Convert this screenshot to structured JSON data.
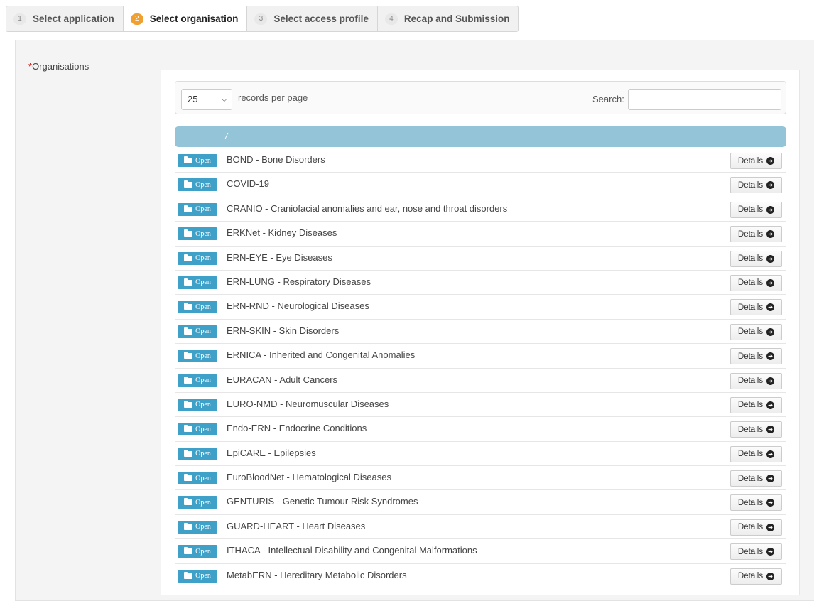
{
  "steps": [
    {
      "num": "1",
      "label": "Select application",
      "active": false
    },
    {
      "num": "2",
      "label": "Select organisation",
      "active": true
    },
    {
      "num": "3",
      "label": "Select access profile",
      "active": false
    },
    {
      "num": "4",
      "label": "Recap and Submission",
      "active": false
    }
  ],
  "form": {
    "required_mark": "*",
    "label": "Organisations"
  },
  "table_controls": {
    "page_size": "25",
    "records_per_page_label": "records per page",
    "search_label": "Search:",
    "search_value": ""
  },
  "table": {
    "header": "/",
    "open_label": "Open",
    "details_label": "Details",
    "rows": [
      "BOND - Bone Disorders",
      "COVID-19",
      "CRANIO - Craniofacial anomalies and ear, nose and throat disorders",
      "ERKNet - Kidney Diseases",
      "ERN-EYE - Eye Diseases",
      "ERN-LUNG - Respiratory Diseases",
      "ERN-RND - Neurological Diseases",
      "ERN-SKIN - Skin Disorders",
      "ERNICA - Inherited and Congenital Anomalies",
      "EURACAN - Adult Cancers",
      "EURO-NMD - Neuromuscular Diseases",
      "Endo-ERN - Endocrine Conditions",
      "EpiCARE - Epilepsies",
      "EuroBloodNet - Hematological Diseases",
      "GENTURIS - Genetic Tumour Risk Syndromes",
      "GUARD-HEART - Heart Diseases",
      "ITHACA - Intellectual Disability and Congenital Malformations",
      "MetabERN - Hereditary Metabolic Disorders"
    ]
  },
  "icons": {
    "open": "folder-open-icon",
    "details": "circle-arrow-right-icon",
    "select": "chevron-down-icon"
  },
  "colors": {
    "active_step": "#f0a030",
    "open_button": "#3fa0c8",
    "table_header": "#93c4d8"
  }
}
